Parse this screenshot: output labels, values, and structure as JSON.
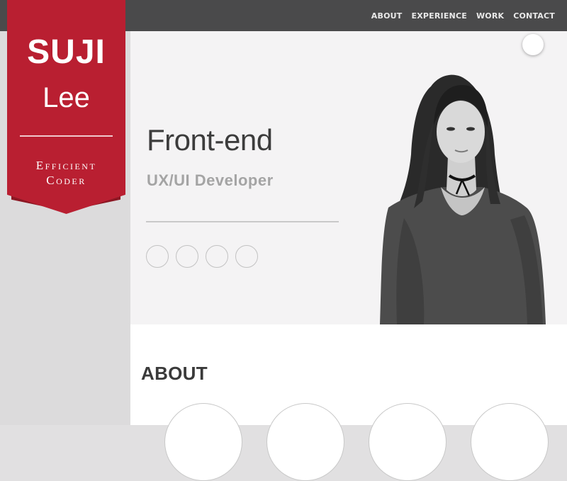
{
  "nav": {
    "items": [
      {
        "label": "ABOUT"
      },
      {
        "label": "EXPERIENCE"
      },
      {
        "label": "WORK"
      },
      {
        "label": "CONTACT"
      }
    ]
  },
  "badge": {
    "first_name": "SUJI",
    "last_name": "Lee",
    "tagline_line1": "Efficient",
    "tagline_line2": "Coder"
  },
  "hero": {
    "title": "Front-end",
    "subtitle": "UX/UI Developer",
    "social_icons": [
      "circle-icon",
      "circle-icon",
      "circle-icon",
      "circle-icon"
    ]
  },
  "about": {
    "heading": "ABOUT"
  },
  "colors": {
    "brand_red": "#b91f31",
    "brand_red_dark": "#8c1723",
    "topbar": "#4a4a4b",
    "hero_text": "#3c3c3c",
    "subtitle_text": "#a4a4a4"
  }
}
